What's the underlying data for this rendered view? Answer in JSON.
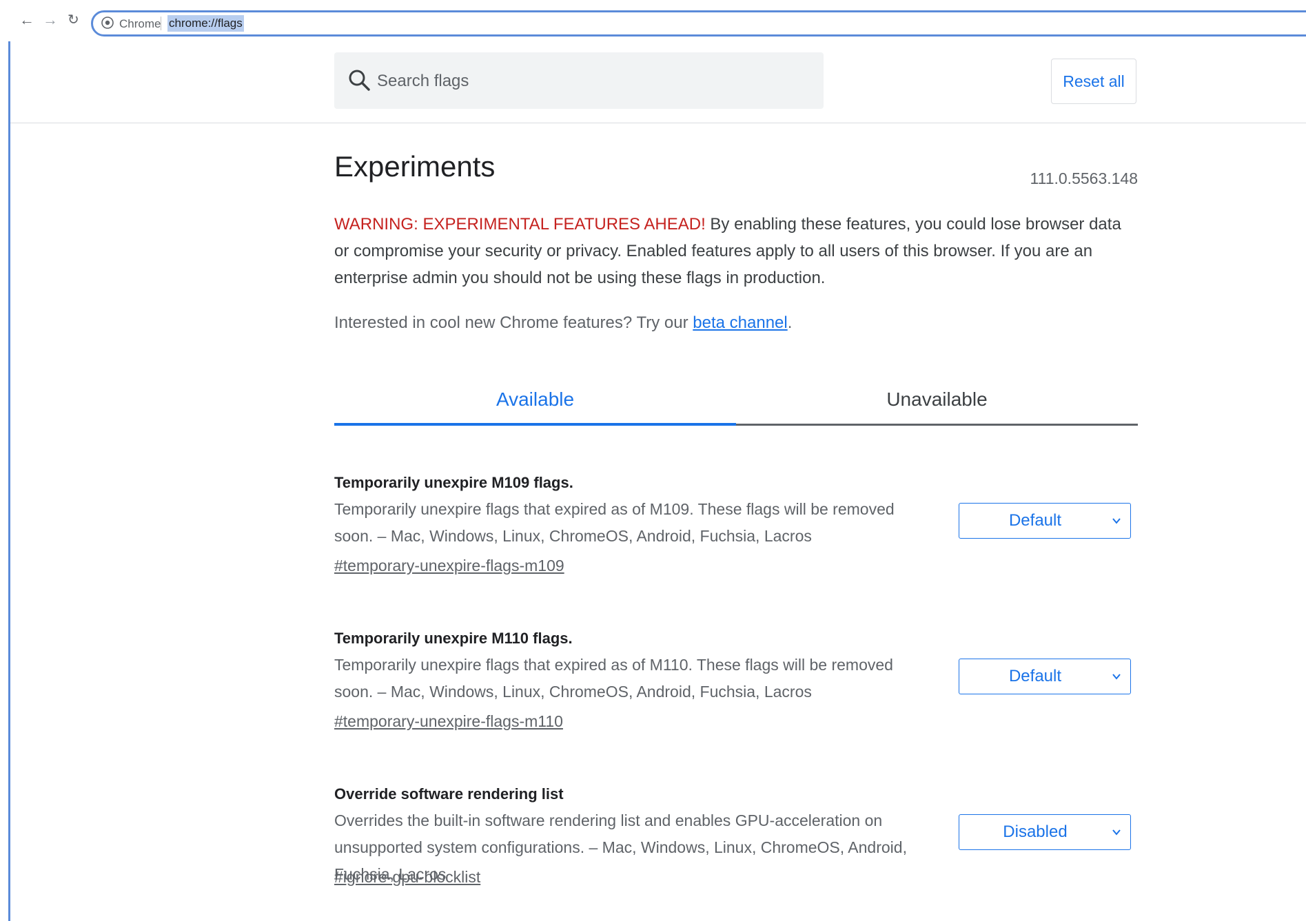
{
  "browser": {
    "site_label": "Chrome",
    "url": "chrome://flags"
  },
  "header": {
    "search_placeholder": "Search flags",
    "reset_label": "Reset all"
  },
  "page": {
    "title": "Experiments",
    "version": "111.0.5563.148",
    "warning_head": "WARNING: EXPERIMENTAL FEATURES AHEAD!",
    "warning_body": " By enabling these features, you could lose browser data or compromise your security or privacy. Enabled features apply to all users of this browser. If you are an enterprise admin you should not be using these flags in production.",
    "promo_text": "Interested in cool new Chrome features? Try our ",
    "promo_link": "beta channel",
    "promo_end": "."
  },
  "tabs": [
    {
      "label": "Available",
      "active": true
    },
    {
      "label": "Unavailable",
      "active": false
    }
  ],
  "flags": [
    {
      "name": "Temporarily unexpire M109 flags.",
      "description": "Temporarily unexpire flags that expired as of M109. These flags will be removed soon. – Mac, Windows, Linux, ChromeOS, Android, Fuchsia, Lacros",
      "link": "#temporary-unexpire-flags-m109",
      "value": "Default"
    },
    {
      "name": "Temporarily unexpire M110 flags.",
      "description": "Temporarily unexpire flags that expired as of M110. These flags will be removed soon. – Mac, Windows, Linux, ChromeOS, Android, Fuchsia, Lacros",
      "link": "#temporary-unexpire-flags-m110",
      "value": "Default"
    },
    {
      "name": "Override software rendering list",
      "description": "Overrides the built-in software rendering list and enables GPU-acceleration on unsupported system configurations. – Mac, Windows, Linux, ChromeOS, Android, Fuchsia, Lacros",
      "link": "#ignore-gpu-blocklist",
      "value": "Disabled"
    }
  ],
  "colors": {
    "accent": "#1a73e8",
    "warning": "#c5221f",
    "frame": "#5b8bd9"
  }
}
